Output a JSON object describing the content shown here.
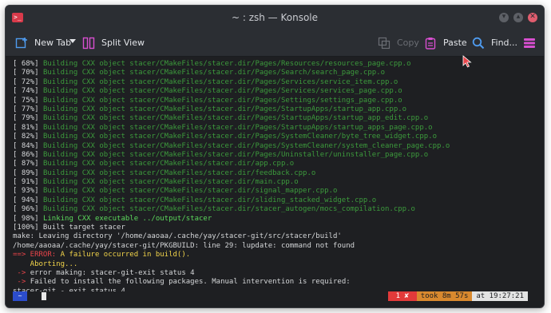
{
  "window": {
    "title": "~ : zsh — Konsole",
    "app_icon_text": ">_"
  },
  "toolbar": {
    "new_tab_label": "New Tab",
    "split_view_label": "Split View",
    "copy_label": "Copy",
    "paste_label": "Paste",
    "find_label": "Find..."
  },
  "terminal": {
    "lines": [
      [
        {
          "text": "[ 68%] ",
          "c": "default"
        },
        {
          "text": "Building CXX object stacer/CMakeFiles/stacer.dir/Pages/Resources/resources_page.cpp.o",
          "c": "dimgreen"
        }
      ],
      [
        {
          "text": "[ 70%] ",
          "c": "default"
        },
        {
          "text": "Building CXX object stacer/CMakeFiles/stacer.dir/Pages/Search/search_page.cpp.o",
          "c": "dimgreen"
        }
      ],
      [
        {
          "text": "[ 72%] ",
          "c": "default"
        },
        {
          "text": "Building CXX object stacer/CMakeFiles/stacer.dir/Pages/Services/service_item.cpp.o",
          "c": "dimgreen"
        }
      ],
      [
        {
          "text": "[ 74%] ",
          "c": "default"
        },
        {
          "text": "Building CXX object stacer/CMakeFiles/stacer.dir/Pages/Services/services_page.cpp.o",
          "c": "dimgreen"
        }
      ],
      [
        {
          "text": "[ 75%] ",
          "c": "default"
        },
        {
          "text": "Building CXX object stacer/CMakeFiles/stacer.dir/Pages/Settings/settings_page.cpp.o",
          "c": "dimgreen"
        }
      ],
      [
        {
          "text": "[ 77%] ",
          "c": "default"
        },
        {
          "text": "Building CXX object stacer/CMakeFiles/stacer.dir/Pages/StartupApps/startup_app.cpp.o",
          "c": "dimgreen"
        }
      ],
      [
        {
          "text": "[ 79%] ",
          "c": "default"
        },
        {
          "text": "Building CXX object stacer/CMakeFiles/stacer.dir/Pages/StartupApps/startup_app_edit.cpp.o",
          "c": "dimgreen"
        }
      ],
      [
        {
          "text": "[ 81%] ",
          "c": "default"
        },
        {
          "text": "Building CXX object stacer/CMakeFiles/stacer.dir/Pages/StartupApps/startup_apps_page.cpp.o",
          "c": "dimgreen"
        }
      ],
      [
        {
          "text": "[ 82%] ",
          "c": "default"
        },
        {
          "text": "Building CXX object stacer/CMakeFiles/stacer.dir/Pages/SystemCleaner/byte_tree_widget.cpp.o",
          "c": "dimgreen"
        }
      ],
      [
        {
          "text": "[ 84%] ",
          "c": "default"
        },
        {
          "text": "Building CXX object stacer/CMakeFiles/stacer.dir/Pages/SystemCleaner/system_cleaner_page.cpp.o",
          "c": "dimgreen"
        }
      ],
      [
        {
          "text": "[ 86%] ",
          "c": "default"
        },
        {
          "text": "Building CXX object stacer/CMakeFiles/stacer.dir/Pages/Uninstaller/uninstaller_page.cpp.o",
          "c": "dimgreen"
        }
      ],
      [
        {
          "text": "[ 87%] ",
          "c": "default"
        },
        {
          "text": "Building CXX object stacer/CMakeFiles/stacer.dir/app.cpp.o",
          "c": "dimgreen"
        }
      ],
      [
        {
          "text": "[ 89%] ",
          "c": "default"
        },
        {
          "text": "Building CXX object stacer/CMakeFiles/stacer.dir/feedback.cpp.o",
          "c": "dimgreen"
        }
      ],
      [
        {
          "text": "[ 91%] ",
          "c": "default"
        },
        {
          "text": "Building CXX object stacer/CMakeFiles/stacer.dir/main.cpp.o",
          "c": "dimgreen"
        }
      ],
      [
        {
          "text": "[ 93%] ",
          "c": "default"
        },
        {
          "text": "Building CXX object stacer/CMakeFiles/stacer.dir/signal_mapper.cpp.o",
          "c": "dimgreen"
        }
      ],
      [
        {
          "text": "[ 94%] ",
          "c": "default"
        },
        {
          "text": "Building CXX object stacer/CMakeFiles/stacer.dir/sliding_stacked_widget.cpp.o",
          "c": "dimgreen"
        }
      ],
      [
        {
          "text": "[ 96%] ",
          "c": "default"
        },
        {
          "text": "Building CXX object stacer/CMakeFiles/stacer.dir/stacer_autogen/mocs_compilation.cpp.o",
          "c": "dimgreen"
        }
      ],
      [
        {
          "text": "[ 98%] ",
          "c": "default"
        },
        {
          "text": "Linking CXX executable ../output/stacer",
          "c": "green"
        }
      ],
      [
        {
          "text": "[100%] Built target stacer",
          "c": "default"
        }
      ],
      [
        {
          "text": "make: Leaving directory '/home/aaoaa/.cache/yay/stacer-git/src/stacer/build'",
          "c": "default"
        }
      ],
      [
        {
          "text": "/home/aaoaa/.cache/yay/stacer-git/PKGBUILD: line 29: lupdate: command not found",
          "c": "default"
        }
      ],
      [
        {
          "text": "==> ERROR: ",
          "c": "red"
        },
        {
          "text": "A failure occurred in build().",
          "c": "yellow"
        }
      ],
      [
        {
          "text": "    Aborting...",
          "c": "yellow"
        }
      ],
      [
        {
          "text": " -> ",
          "c": "red"
        },
        {
          "text": "error making: stacer-git-exit status 4",
          "c": "default"
        }
      ],
      [
        {
          "text": " -> ",
          "c": "red"
        },
        {
          "text": "Failed to install the following packages. Manual intervention is required:",
          "c": "default"
        }
      ],
      [
        {
          "text": "stacer-git - exit status 4",
          "c": "default"
        }
      ]
    ]
  },
  "statusbar": {
    "prompt_label": "~",
    "error_label": "1 ✘",
    "took_label": "took 8m 57s",
    "time_label": "at 19:27:21",
    "colors": {
      "error_bg": "#e23a3a",
      "took_bg": "#d9892e",
      "time_bg": "#e3e3e3",
      "prompt_bg": "#2c4dcc"
    }
  }
}
